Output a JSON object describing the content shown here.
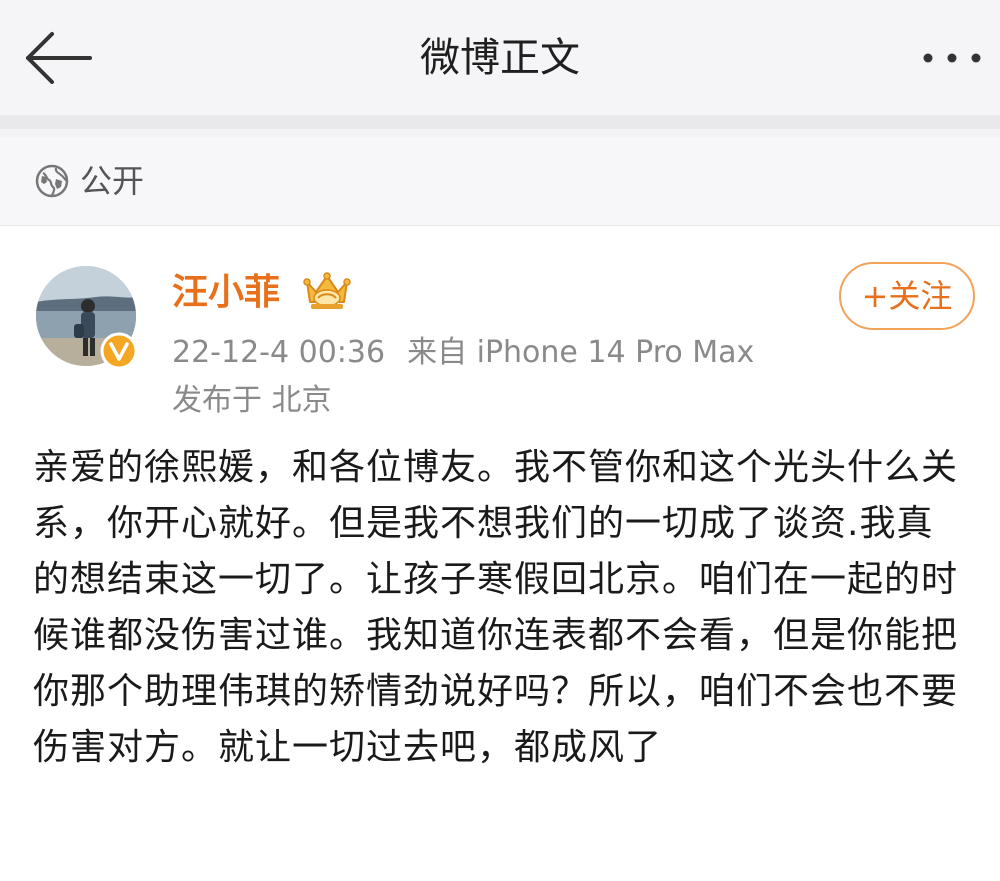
{
  "header": {
    "title": "微博正文",
    "back_icon": "back-arrow-icon",
    "more_icon": "more-dots-icon"
  },
  "visibility": {
    "icon": "globe-icon",
    "label": "公开"
  },
  "author": {
    "name": "汪小菲",
    "verified_badge": "verified-v-icon",
    "member_icon": "crown-icon",
    "follow_label": "+关注",
    "timestamp": "22-12-4 00:36",
    "source": "来自 iPhone 14 Pro Max",
    "location": "发布于 北京"
  },
  "post": {
    "text": "亲爱的徐熙媛，和各位博友。我不管你和这个光头什么关系，你开心就好。但是我不想我们的一切成了谈资.我真的想结束这一切了。让孩子寒假回北京。咱们在一起的时候谁都没伤害过谁。我知道你连表都不会看，但是你能把你那个助理伟琪的矫情劲说好吗？所以，咱们不会也不要伤害对方。就让一切过去吧，都成风了"
  },
  "colors": {
    "accent": "#e8701a",
    "follow_border": "#f0a35a",
    "meta_text": "#8a8a8a",
    "header_bg": "#f5f5f7"
  }
}
